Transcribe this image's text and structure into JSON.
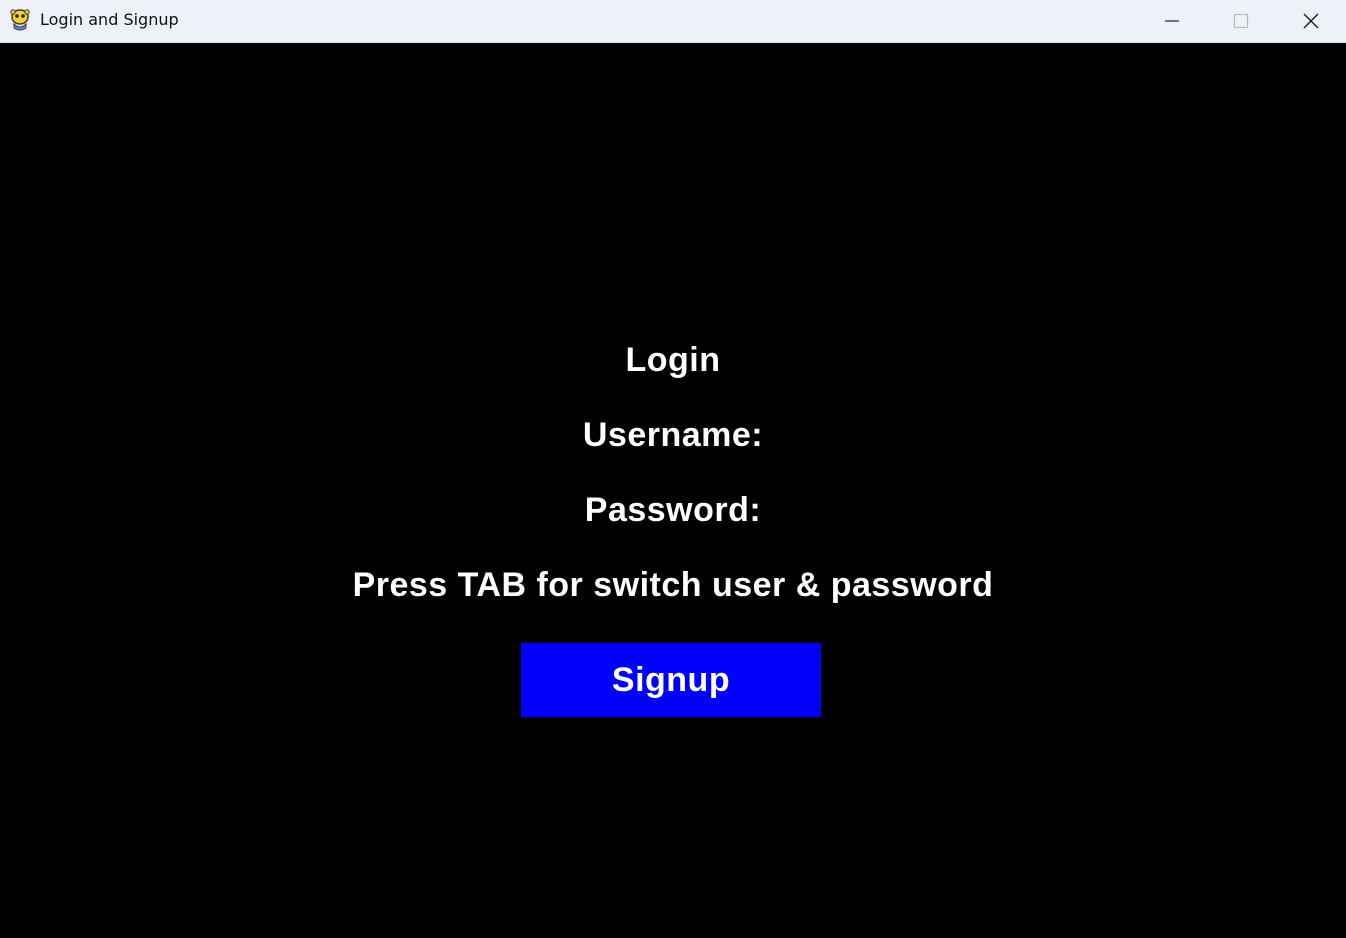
{
  "window": {
    "title": "Login and Signup",
    "app_icon": "pygame-snake-icon",
    "controls": [
      "minimize-icon",
      "maximize-icon",
      "close-icon"
    ]
  },
  "form": {
    "heading": "Login",
    "username_label": "Username:",
    "password_label": "Password:",
    "hint": "Press TAB for switch user & password",
    "signup_label": "Signup"
  },
  "colors": {
    "background": "#000000",
    "text": "#ffffff",
    "button": "#0000ff",
    "titlebar": "#eef1f8"
  }
}
